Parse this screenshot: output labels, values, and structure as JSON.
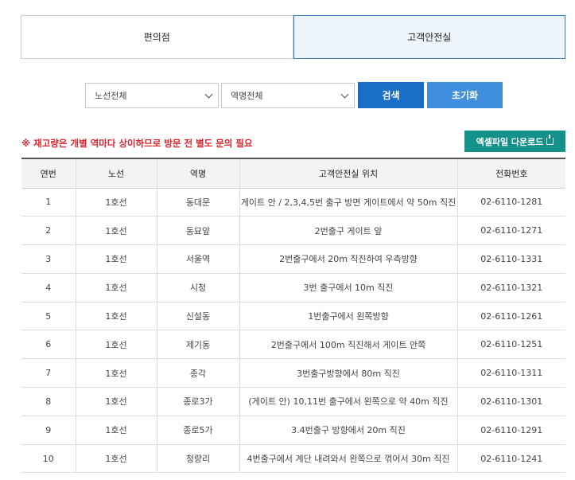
{
  "tabs": [
    {
      "label": "편의점",
      "active": false
    },
    {
      "label": "고객안전실",
      "active": true
    }
  ],
  "filters": {
    "line_select": "노선전체",
    "station_select": "역명전체",
    "search_label": "검색",
    "reset_label": "초기화"
  },
  "notice": "※ 재고량은 개별 역마다 상이하므로 방문 전 별도 문의 필요",
  "excel_label": "엑셀파일 다운로드",
  "table": {
    "headers": [
      "연번",
      "노선",
      "역명",
      "고객안전실 위치",
      "전화번호"
    ],
    "rows": [
      [
        "1",
        "1호선",
        "동대문",
        "게이트 안 / 2,3,4,5번 출구 방면 게이트에서 약 50m 직진",
        "02-6110-1281"
      ],
      [
        "2",
        "1호선",
        "동묘앞",
        "2번출구 게이트 앞",
        "02-6110-1271"
      ],
      [
        "3",
        "1호선",
        "서울역",
        "2번출구에서 20m 직진하여 우측방향",
        "02-6110-1331"
      ],
      [
        "4",
        "1호선",
        "시청",
        "3번 출구에서 10m 직진",
        "02-6110-1321"
      ],
      [
        "5",
        "1호선",
        "신설동",
        "1번출구에서 왼쪽방향",
        "02-6110-1261"
      ],
      [
        "6",
        "1호선",
        "제기동",
        "2번출구에서 100m 직진해서 게이트 안쪽",
        "02-6110-1251"
      ],
      [
        "7",
        "1호선",
        "종각",
        "3번출구방향에서 80m 직진",
        "02-6110-1311"
      ],
      [
        "8",
        "1호선",
        "종로3가",
        "(게이트 안) 10,11번 출구에서 왼쪽으로 약 40m 직진",
        "02-6110-1301"
      ],
      [
        "9",
        "1호선",
        "종로5가",
        "3.4번출구 방향에서 20m 직진",
        "02-6110-1291"
      ],
      [
        "10",
        "1호선",
        "청량리",
        "4번출구에서 계단 내려와서 왼쪽으로 꺾어서 30m 직진",
        "02-6110-1241"
      ]
    ]
  }
}
